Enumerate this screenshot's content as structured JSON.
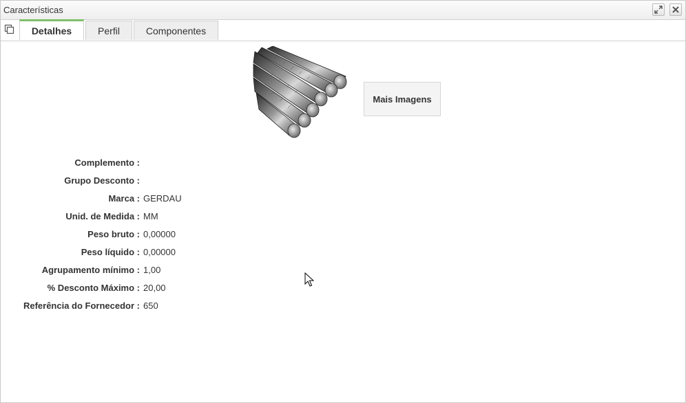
{
  "window": {
    "title": "Características",
    "buttons": [
      {
        "name": "maximize-button",
        "icon": "expand-icon"
      },
      {
        "name": "close-button",
        "icon": "close-icon"
      }
    ]
  },
  "tabs": [
    {
      "label": "Detalhes",
      "active": true
    },
    {
      "label": "Perfil",
      "active": false
    },
    {
      "label": "Componentes",
      "active": false
    }
  ],
  "product": {
    "image_icon": "steel-rebar-bundle-image",
    "more_images_label": "Mais Imagens"
  },
  "details": [
    {
      "label": "Complemento :",
      "value": ""
    },
    {
      "label": "Grupo Desconto :",
      "value": ""
    },
    {
      "label": "Marca :",
      "value": "GERDAU"
    },
    {
      "label": "Unid. de Medida :",
      "value": "MM"
    },
    {
      "label": "Peso bruto :",
      "value": "0,00000"
    },
    {
      "label": "Peso líquido :",
      "value": "0,00000"
    },
    {
      "label": "Agrupamento mínimo :",
      "value": "1,00"
    },
    {
      "label": "% Desconto Máximo :",
      "value": "20,00"
    },
    {
      "label": "Referência do Fornecedor :",
      "value": "650"
    }
  ],
  "colors": {
    "active_tab_accent": "#7fc06b",
    "text": "#333333"
  }
}
